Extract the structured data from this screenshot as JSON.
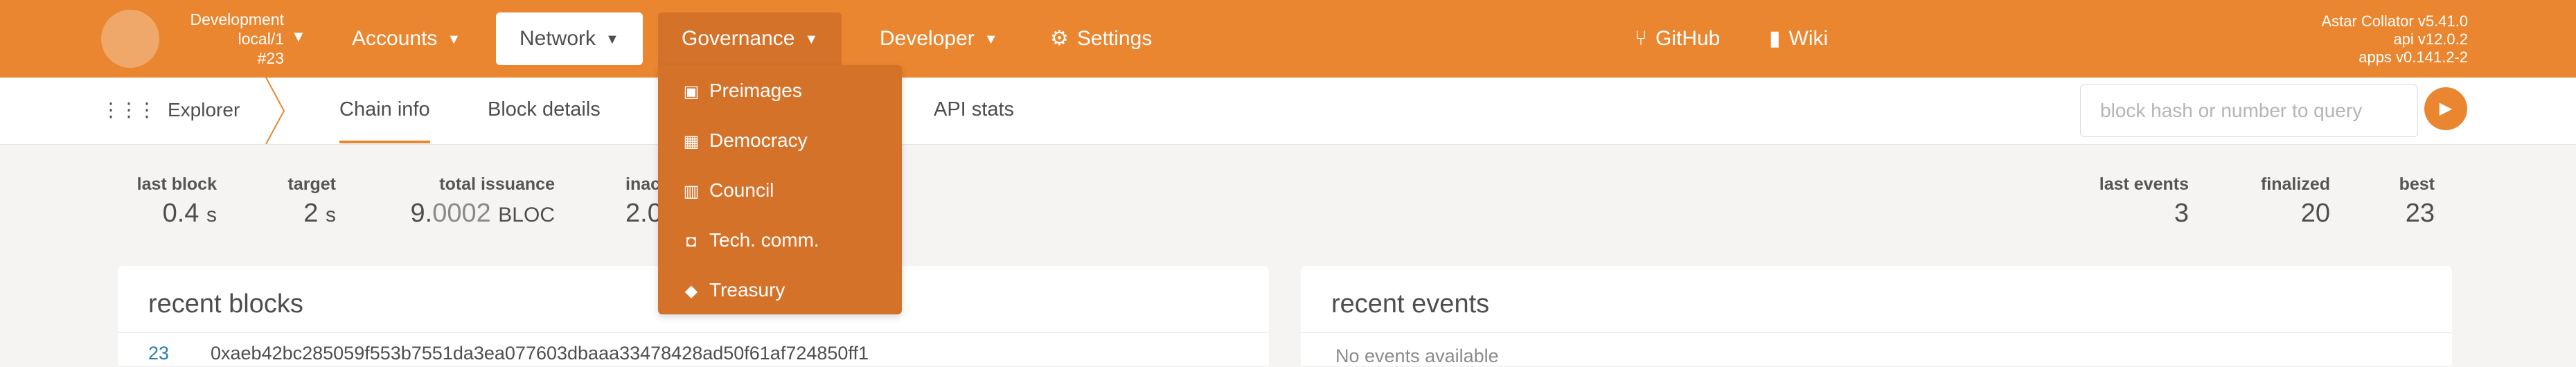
{
  "chain": {
    "name": "Development",
    "endpoint": "local/1",
    "block": "#23"
  },
  "nav": {
    "accounts": "Accounts",
    "network": "Network",
    "governance": "Governance",
    "developer": "Developer",
    "settings": "Settings",
    "github": "GitHub",
    "wiki": "Wiki"
  },
  "version": {
    "node": "Astar Collator v5.41.0",
    "api": "api v12.0.2",
    "apps": "apps v0.141.2-2"
  },
  "governance_menu": {
    "items": [
      "Preimages",
      "Democracy",
      "Council",
      "Tech. comm.",
      "Treasury"
    ],
    "icons": [
      "image-icon",
      "calendar-check-icon",
      "building-icon",
      "microchip-icon",
      "gem-icon"
    ]
  },
  "subnav": {
    "section": "Explorer",
    "tabs": [
      "Chain info",
      "Block details",
      "API stats"
    ],
    "active_tab": "Chain info",
    "search_placeholder": "block hash or number to query"
  },
  "stats": {
    "last_block": {
      "label": "last block",
      "value": "0.4",
      "unit": "s"
    },
    "target": {
      "label": "target",
      "value": "2",
      "unit": "s"
    },
    "total_issuance": {
      "label": "total issuance",
      "int": "9.",
      "frac": "0002",
      "unit": "BLOC"
    },
    "inactive": {
      "label": "inac",
      "value": "2.0"
    },
    "last_events": {
      "label": "last events",
      "value": "3"
    },
    "finalized": {
      "label": "finalized",
      "value": "20"
    },
    "best": {
      "label": "best",
      "value": "23"
    }
  },
  "recent_blocks": {
    "title": "recent blocks",
    "rows": [
      {
        "number": "23",
        "hash": "0xaeb42bc285059f553b7551da3ea077603dbaaa33478428ad50f61af724850ff1"
      }
    ]
  },
  "recent_events": {
    "title": "recent events",
    "empty": "No events available"
  },
  "colors": {
    "brand": "#ea8630",
    "dropdown": "#d4722a",
    "block_link": "#2b7fa8"
  }
}
